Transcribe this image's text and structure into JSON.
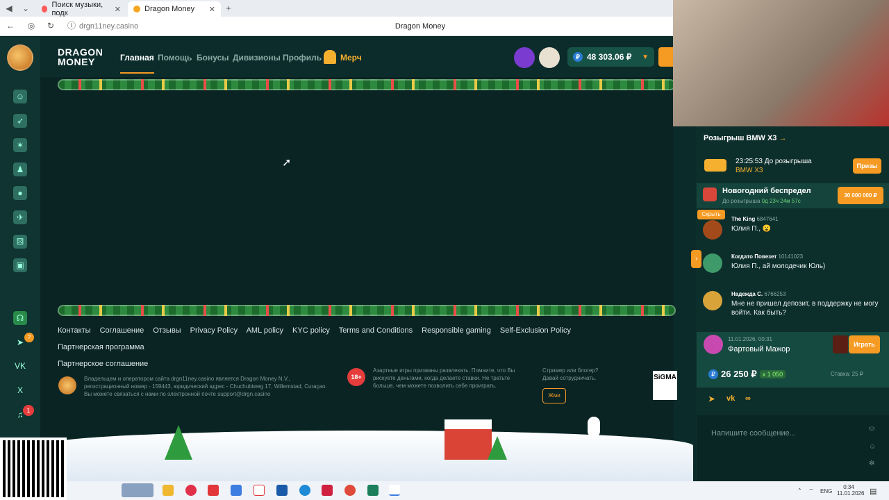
{
  "browser": {
    "tabs": [
      {
        "label": "Поиск музыки, подк",
        "active": false
      },
      {
        "label": "Dragon Money",
        "active": true
      }
    ],
    "url": "drgn11ney.casino",
    "page_title": "Dragon Money"
  },
  "site": {
    "brand_line1": "DRAGON",
    "brand_line2": "MONEY",
    "nav": [
      {
        "label": "Главная",
        "active": true
      },
      {
        "label": "Помощь"
      },
      {
        "label": "Бонусы"
      },
      {
        "label": "Дивизионы"
      },
      {
        "label": "Профиль"
      },
      {
        "label": "Мерч"
      }
    ],
    "balance": "48 303.06 ₽",
    "footer_links": [
      "Контакты",
      "Соглашение",
      "Отзывы",
      "Privacy Policy",
      "AML policy",
      "KYC policy",
      "Terms and Conditions",
      "Responsible gaming",
      "Self-Exclusion Policy",
      "Партнерская программа",
      "Партнерское соглашение"
    ],
    "legal_text": "Владельцем и оператором сайта drgn11ney.casino является Dragon Money N.V., регистрационный номер - 159443, юридический адрес - Chuchubiweg 17, Willemstad, Curaçao. Вы можете связаться с нами по электронной почте support@drgn.casino",
    "age_badge": "18+",
    "gambling_text": "Азартные игры призваны развлекать. Помните, что Вы рискуете деньгами, когда делаете ставки. Не тратьте больше, чем можете позволить себе проиграть.",
    "streamer_text": "Стример или блогер? Давай сотрудничать.",
    "write_btn": "Жми",
    "sigma_text": "SiGMA",
    "sidebar_badges": {
      "telegram": "?",
      "bell": "1"
    },
    "sidebar_labels": {
      "vk": "VK",
      "x": "X"
    }
  },
  "chat": {
    "raffle_title": "Розыгрыш BMW X3",
    "raffle_timer": "23:25:53 До розыгрыша",
    "raffle_car": "BMW X3",
    "prizes_btn": "Призы",
    "event_title": "Новогодний беспредел",
    "event_countdown_label": "До розыгрыша",
    "event_countdown": "0д 23ч 24м 57с",
    "event_prize": "30 000 000 ₽",
    "hide_btn": "Скрыть",
    "messages": [
      {
        "name": "The King",
        "id": "6847641",
        "text": "Юлия П., 😮"
      },
      {
        "name": "Когдато Повезет",
        "id": "10141023",
        "text": "Юлия П., ай молодечик Юль)"
      },
      {
        "name": "Надежда С.",
        "id": "6766253",
        "text": "Мне не пришел депозит, в поддержку не могу войти. Как быть?"
      }
    ],
    "winner": {
      "time": "11.01.2026, 00:31",
      "name": "Фартовый Мажор",
      "play_btn": "Играть",
      "amount": "26 250 ₽",
      "multiplier": "x 1 050",
      "bet_label": "Ставка:",
      "bet_value": "25 ₽"
    },
    "input_placeholder": "Напишите сообщение..."
  },
  "taskbar": {
    "lang": "ENG",
    "time": "0:34",
    "date": "11.01.2026"
  }
}
